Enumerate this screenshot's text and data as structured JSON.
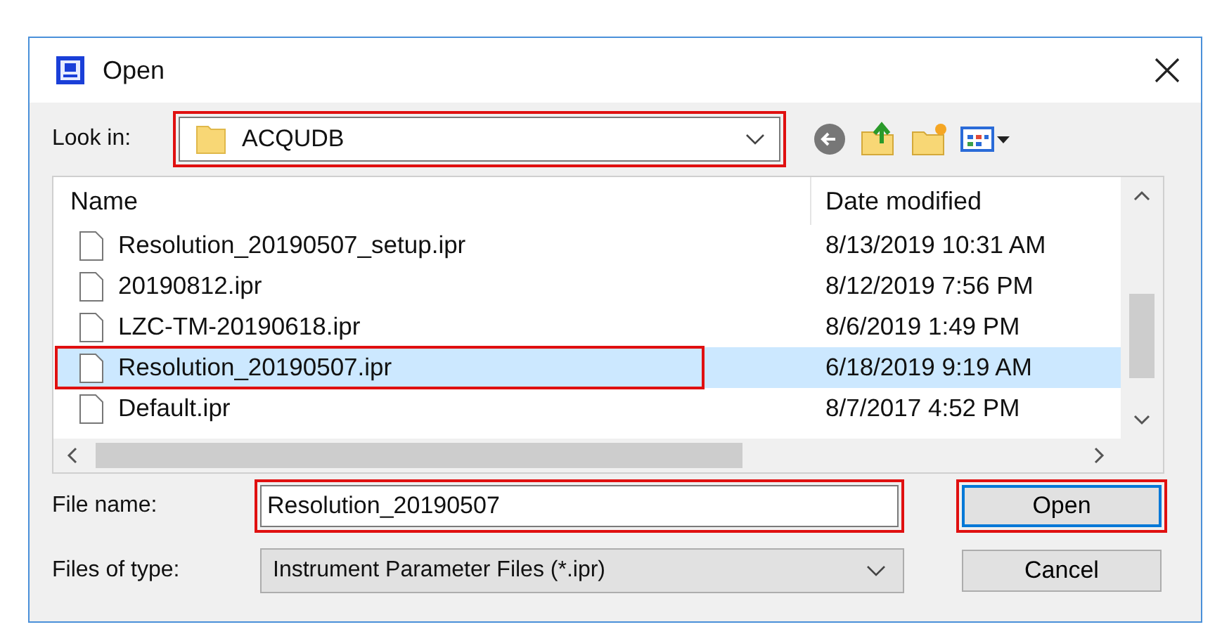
{
  "window": {
    "title": "Open"
  },
  "look_in": {
    "label": "Look in:",
    "value": "ACQUDB",
    "highlighted": true
  },
  "columns": [
    "Name",
    "Date modified"
  ],
  "files": [
    {
      "name": "Resolution_20190507_setup.ipr",
      "date": "8/13/2019 10:31 AM",
      "selected": false,
      "highlighted": false
    },
    {
      "name": "20190812.ipr",
      "date": "8/12/2019 7:56 PM",
      "selected": false,
      "highlighted": false
    },
    {
      "name": "LZC-TM-20190618.ipr",
      "date": "8/6/2019 1:49 PM",
      "selected": false,
      "highlighted": false
    },
    {
      "name": "Resolution_20190507.ipr",
      "date": "6/18/2019 9:19 AM",
      "selected": true,
      "highlighted": true
    },
    {
      "name": "Default.ipr",
      "date": "8/7/2017 4:52 PM",
      "selected": false,
      "highlighted": false
    }
  ],
  "file_name": {
    "label": "File name:",
    "value": "Resolution_20190507",
    "highlighted": true
  },
  "file_type": {
    "label": "Files of type:",
    "value": "Instrument Parameter Files (*.ipr)"
  },
  "buttons": [
    {
      "label": "Open",
      "kind": "default",
      "highlighted": true
    },
    {
      "label": "Cancel",
      "kind": "normal"
    }
  ]
}
